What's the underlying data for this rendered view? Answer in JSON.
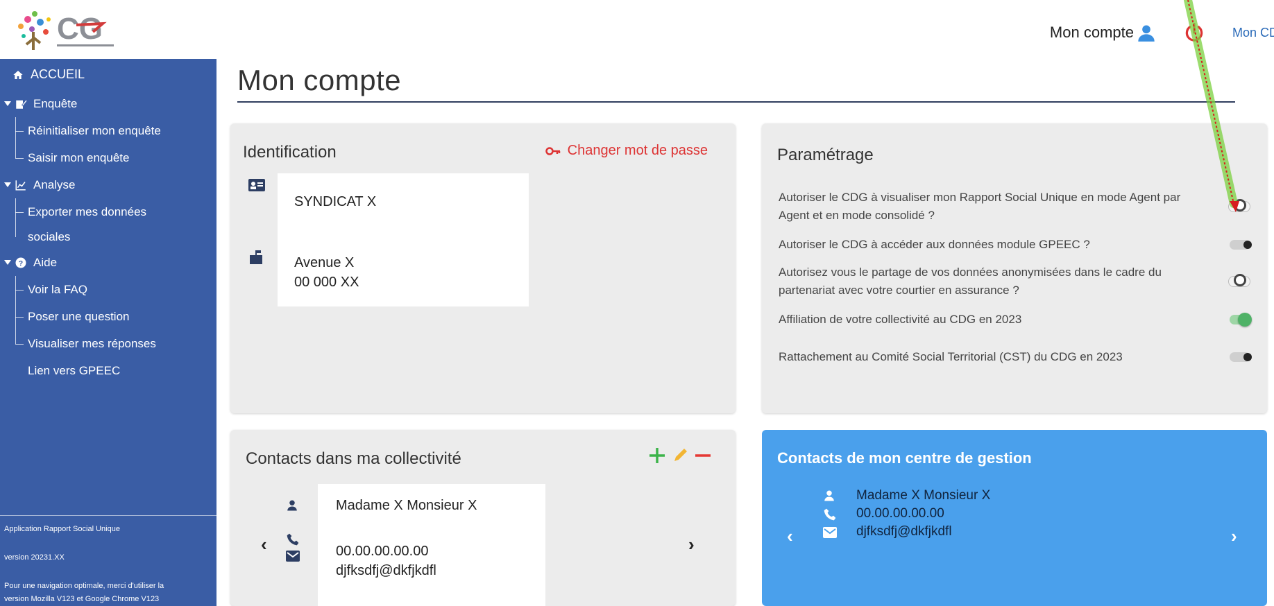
{
  "colors": {
    "sidebar": "#3a5da5",
    "accent_red": "#d33333",
    "link_blue": "#2a6ab8",
    "centre_card": "#4aa0ec",
    "toggle_on": "#4fb267",
    "annotation_green": "#7bd13f"
  },
  "header": {
    "account_label": "Mon compte",
    "account_icon": "user-icon",
    "power_icon": "power-icon",
    "cdg_link": "Mon CDG"
  },
  "sidebar": {
    "items": [
      {
        "label": "ACCUEIL",
        "icon": "home-icon"
      },
      {
        "label": "Enquête",
        "icon": "edit-icon"
      },
      {
        "label": "Réinitialiser mon enquête"
      },
      {
        "label": "Saisir mon enquête"
      },
      {
        "label": "Analyse",
        "icon": "chart-icon"
      },
      {
        "label": "Exporter mes données"
      },
      {
        "label": "sociales"
      },
      {
        "label": "Aide",
        "icon": "help-icon"
      },
      {
        "label": "Voir la FAQ"
      },
      {
        "label": "Poser une question"
      },
      {
        "label": "Visualiser mes réponses"
      },
      {
        "label": "Lien vers GPEEC"
      }
    ],
    "footer": {
      "app_name": "Application Rapport Social Unique",
      "version": "version 20231.XX",
      "browser_note_1": "Pour une navigation optimale, merci d'utiliser la",
      "browser_note_2": "version Mozilla V123 et Google Chrome V123"
    }
  },
  "main": {
    "title": "Mon compte"
  },
  "identification": {
    "title": "Identification",
    "change_password": "Changer mot de passe",
    "name": "SYNDICAT X",
    "address_line1": "Avenue X",
    "address_line2": "00 000 XX"
  },
  "parametrage": {
    "title": "Paramétrage",
    "rows": [
      {
        "text": "Autoriser le CDG à visualiser mon Rapport Social Unique en mode Agent par Agent et en mode consolidé ?",
        "state": "indeterminate"
      },
      {
        "text": "Autoriser le CDG à accéder aux données module GPEEC ?",
        "state": "off"
      },
      {
        "text": "Autorisez vous le partage de vos données anonymisées dans le cadre du partenariat avec votre courtier en assurance ?",
        "state": "indeterminate"
      },
      {
        "text": "Affiliation de votre collectivité au CDG en 2023",
        "state": "on"
      },
      {
        "text": "Rattachement au Comité Social Territorial (CST) du CDG en 2023",
        "state": "off"
      }
    ]
  },
  "contacts_collectivite": {
    "title": "Contacts dans ma collectivité",
    "name": "Madame X Monsieur X",
    "phone": "00.00.00.00.00",
    "email": "djfksdfj@dkfjkdfl",
    "prev": "‹",
    "next": "›"
  },
  "contacts_centre": {
    "title": "Contacts de mon centre de gestion",
    "name": "Madame X Monsieur X",
    "phone": "00.00.00.00.00",
    "email": "djfksdfj@dkfjkdfl",
    "prev": "‹",
    "next": "›"
  }
}
